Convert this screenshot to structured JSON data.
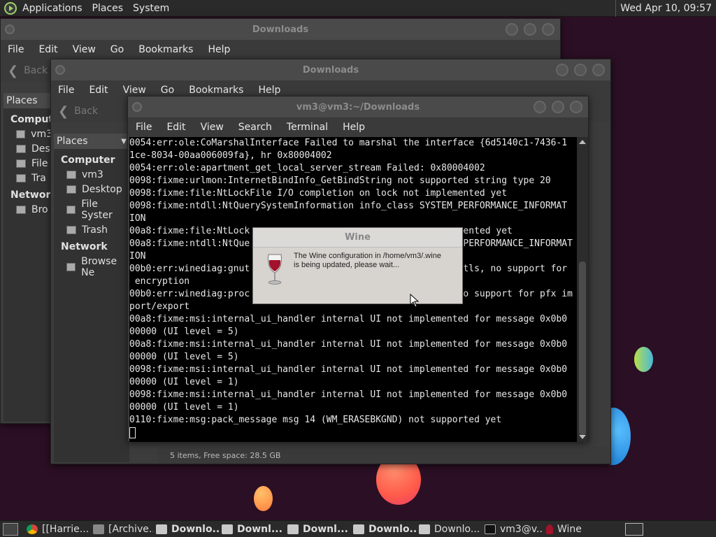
{
  "top_panel": {
    "menus": [
      "Applications",
      "Places",
      "System"
    ],
    "clock": "Wed Apr 10, 09:57"
  },
  "window_back": {
    "title": "Downloads",
    "menu": [
      "File",
      "Edit",
      "View",
      "Go",
      "Bookmarks",
      "Help"
    ],
    "back_label": "Back",
    "places_label": "Places",
    "groups": [
      {
        "label": "Computer",
        "items": [
          "vm3",
          "Des",
          "File",
          "Tra"
        ]
      },
      {
        "label": "Network",
        "items": [
          "Bro"
        ]
      }
    ]
  },
  "window_mid": {
    "title": "Downloads",
    "menu": [
      "File",
      "Edit",
      "View",
      "Go",
      "Bookmarks",
      "Help"
    ],
    "back_label": "Back",
    "places_label": "Places",
    "computer_label": "Computer",
    "computer_items": [
      "vm3",
      "Desktop",
      "File Syster",
      "Trash"
    ],
    "network_label": "Network",
    "network_items": [
      "Browse Ne"
    ],
    "status": "5 items, Free space: 28.5 GB"
  },
  "terminal": {
    "title": "vm3@vm3:~/Downloads",
    "menu": [
      "File",
      "Edit",
      "View",
      "Search",
      "Terminal",
      "Help"
    ],
    "lines": [
      "0054:err:ole:CoMarshalInterface Failed to marshal the interface {6d5140c1-7436-1",
      "1ce-8034-00aa006009fa}, hr 0x80004002",
      "0054:err:ole:apartment_get_local_server_stream Failed: 0x80004002",
      "0098:fixme:urlmon:InternetBindInfo_GetBindString not supported string type 20",
      "0098:fixme:file:NtLockFile I/O completion on lock not implemented yet",
      "0098:fixme:ntdll:NtQuerySystemInformation info_class SYSTEM_PERFORMANCE_INFORMAT",
      "ION",
      "00a8:fixme:file:NtLock                                      mented yet",
      "00a8:fixme:ntdll:NtQue                                      _PERFORMANCE_INFORMAT",
      "ION",
      "00b0:err:winediag:gnut                                      utls, no support for",
      " encryption",
      "00b0:err:winediag:proc                                      no support for pfx im",
      "port/export",
      "00a8:fixme:msi:internal_ui_handler internal UI not implemented for message 0x0b0",
      "00000 (UI level = 5)",
      "00a8:fixme:msi:internal_ui_handler internal UI not implemented for message 0x0b0",
      "00000 (UI level = 5)",
      "0098:fixme:msi:internal_ui_handler internal UI not implemented for message 0x0b0",
      "00000 (UI level = 1)",
      "0098:fixme:msi:internal_ui_handler internal UI not implemented for message 0x0b0",
      "00000 (UI level = 1)",
      "0110:fixme:msg:pack_message msg 14 (WM_ERASEBKGND) not supported yet"
    ]
  },
  "wine_dialog": {
    "title": "Wine",
    "message": "The Wine configuration in /home/vm3/.wine is being updated, please wait..."
  },
  "taskbar": {
    "items": [
      {
        "label": "[[Harrie...",
        "icon": "chrome-icon",
        "bold": false
      },
      {
        "label": "[Archive...",
        "icon": "archive-manager-icon",
        "bold": false
      },
      {
        "label": "Downlo...",
        "icon": "folder-icon",
        "bold": true
      },
      {
        "label": "Downl...",
        "icon": "folder-icon",
        "bold": true
      },
      {
        "label": "Downl...",
        "icon": "folder-icon",
        "bold": true
      },
      {
        "label": "Downlo...",
        "icon": "folder-icon",
        "bold": true
      },
      {
        "label": "Downlo...",
        "icon": "folder-icon",
        "bold": false
      },
      {
        "label": "vm3@v...",
        "icon": "terminal-icon",
        "bold": false
      },
      {
        "label": "Wine",
        "icon": "wine-icon",
        "bold": false
      }
    ]
  },
  "colors": {
    "desktop": "#2b0f24",
    "panel": "#2a2a2a",
    "window": "#3c3c3c",
    "terminal_bg": "#000000",
    "dialog_bg": "#d7d3cf"
  }
}
